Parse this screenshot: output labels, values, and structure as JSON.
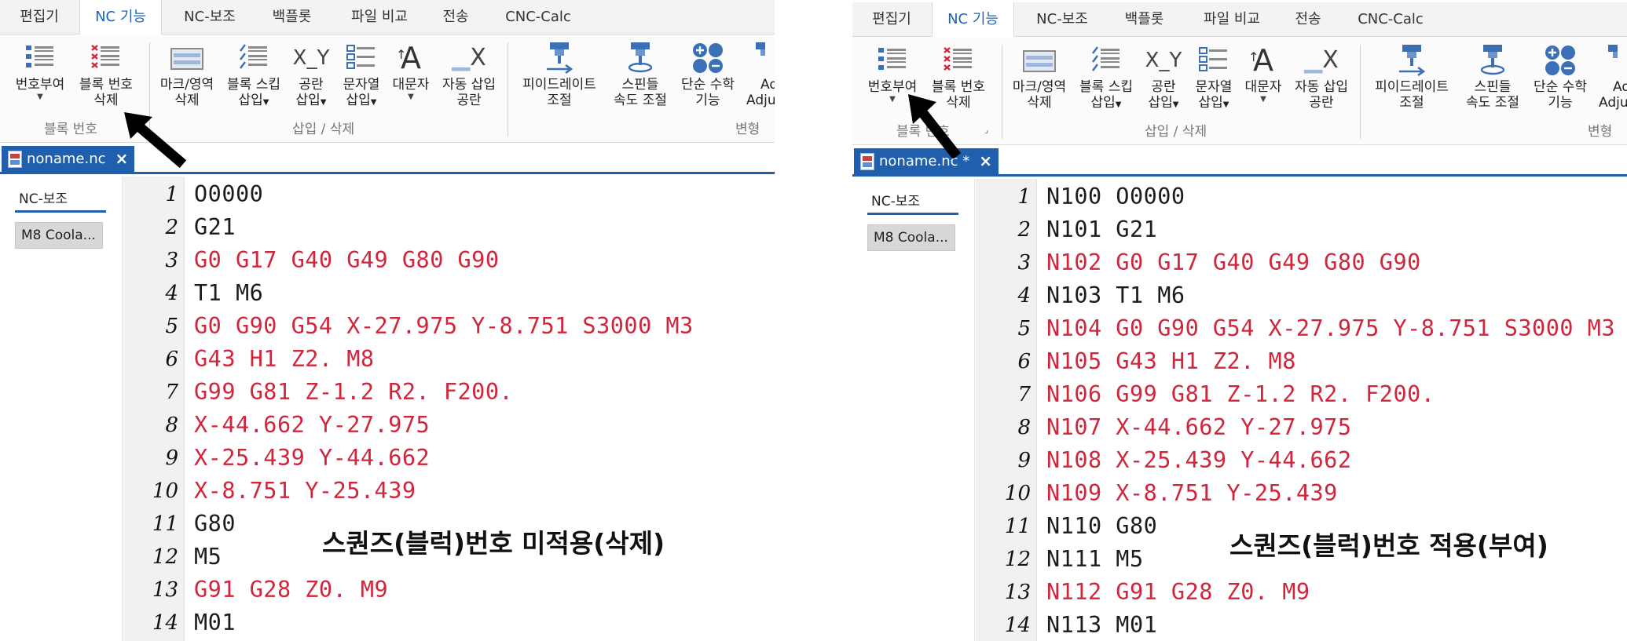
{
  "menu_tabs": [
    "편집기",
    "NC 기능",
    "NC-보조",
    "백플롯",
    "파일 비교",
    "전송",
    "CNC-Calc"
  ],
  "ribbon": {
    "number_assign": "번호부여",
    "block_delete_1": "블록 번호",
    "block_delete_2": "삭제",
    "mark_delete_1": "마크/영역",
    "mark_delete_2": "삭제",
    "block_skip_1": "블록 스킵",
    "block_skip_2": "삽입",
    "space_insert_1": "공란",
    "space_insert_2": "삽입",
    "string_insert_1": "문자열",
    "string_insert_2": "삽입",
    "uppercase": "대문자",
    "auto_space_1": "자동 삽입",
    "auto_space_2": "공란",
    "feedrate_1": "피이드레이트",
    "feedrate_2": "조절",
    "spindle_1": "스핀들",
    "spindle_2": "속도 조절",
    "math_1": "단순 수학",
    "math_2": "기능",
    "adjust_1": "Ad",
    "adjust_2": "Adju",
    "group_block": "블록 번호",
    "group_insert": "삽입 / 삭제",
    "group_transform": "변형",
    "icon_text_space": "X_Y",
    "icon_text_upper": "A",
    "icon_text_autospace": "X"
  },
  "left": {
    "doc_tab": "noname.nc",
    "side_tab": "NC-보조",
    "side_button": "M8 Coola...",
    "caption": "스퀀즈(블럭)번호 미적용(삭제)",
    "lines": [
      {
        "n": "1",
        "text": "O0000",
        "red": false
      },
      {
        "n": "2",
        "text": "G21",
        "red": false
      },
      {
        "n": "3",
        "text": "G0 G17 G40 G49 G80 G90",
        "red": true
      },
      {
        "n": "4",
        "text": "T1 M6",
        "red": false
      },
      {
        "n": "5",
        "text": "G0 G90 G54 X-27.975 Y-8.751 S3000 M3",
        "red": true
      },
      {
        "n": "6",
        "text": "G43 H1 Z2. M8",
        "red": true
      },
      {
        "n": "7",
        "text": "G99 G81 Z-1.2 R2. F200.",
        "red": true
      },
      {
        "n": "8",
        "text": "X-44.662 Y-27.975",
        "red": true
      },
      {
        "n": "9",
        "text": "X-25.439 Y-44.662",
        "red": true
      },
      {
        "n": "10",
        "text": "X-8.751 Y-25.439",
        "red": true
      },
      {
        "n": "11",
        "text": "G80",
        "red": false
      },
      {
        "n": "12",
        "text": "M5",
        "red": false
      },
      {
        "n": "13",
        "text": "G91 G28 Z0. M9",
        "red": true
      },
      {
        "n": "14",
        "text": "M01",
        "red": false
      }
    ]
  },
  "right": {
    "doc_tab": "noname.nc *",
    "side_tab": "NC-보조",
    "side_button": "M8 Coola...",
    "caption": "스퀀즈(블럭)번호 적용(부여)",
    "lines": [
      {
        "n": "1",
        "text": "N100 O0000",
        "red": false
      },
      {
        "n": "2",
        "text": "N101 G21",
        "red": false
      },
      {
        "n": "3",
        "text": "N102 G0 G17 G40 G49 G80 G90",
        "red": true
      },
      {
        "n": "4",
        "text": "N103 T1 M6",
        "red": false
      },
      {
        "n": "5",
        "text": "N104 G0 G90 G54 X-27.975 Y-8.751 S3000 M3",
        "red": true
      },
      {
        "n": "6",
        "text": "N105 G43 H1 Z2. M8",
        "red": true
      },
      {
        "n": "7",
        "text": "N106 G99 G81 Z-1.2 R2. F200.",
        "red": true
      },
      {
        "n": "8",
        "text": "N107 X-44.662 Y-27.975",
        "red": true
      },
      {
        "n": "9",
        "text": "N108 X-25.439 Y-44.662",
        "red": true
      },
      {
        "n": "10",
        "text": "N109 X-8.751 Y-25.439",
        "red": true
      },
      {
        "n": "11",
        "text": "N110 G80",
        "red": false
      },
      {
        "n": "12",
        "text": "N111 M5",
        "red": false
      },
      {
        "n": "13",
        "text": "N112 G91 G28 Z0. M9",
        "red": true
      },
      {
        "n": "14",
        "text": "N113 M01",
        "red": false
      }
    ]
  },
  "colors": {
    "accent": "#1f5fae",
    "code_red": "#d0263c",
    "active_tab_text": "#1f63b5"
  }
}
